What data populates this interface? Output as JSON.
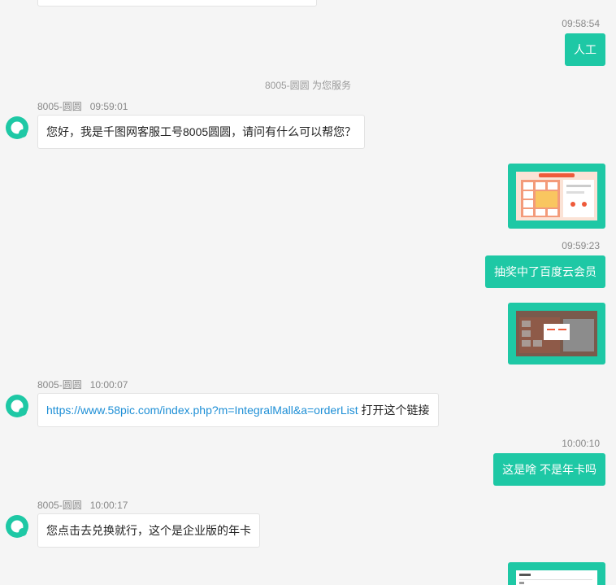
{
  "messages": [
    {
      "time": "09:58:54",
      "text": "人工"
    },
    {
      "system": "8005-圆圆 为您服务"
    },
    {
      "sender": "8005-圆圆",
      "time": "09:59:01",
      "text": "您好，我是千图网客服工号8005圆圆，请问有什么可以帮您？"
    },
    {
      "image": "prize-wheel-screenshot"
    },
    {
      "time": "09:59:23",
      "text": "抽奖中了百度云会员"
    },
    {
      "image": "prize-popup-screenshot"
    },
    {
      "sender": "8005-圆圆",
      "time": "10:00:07",
      "link": "https://www.58pic.com/index.php?m=IntegralMall&a=orderList",
      "text": " 打开这个链接"
    },
    {
      "time": "10:00:10",
      "text": "这是啥 不是年卡吗"
    },
    {
      "sender": "8005-圆圆",
      "time": "10:00:17",
      "text": "您点击去兑换就行，这个是企业版的年卡"
    },
    {
      "image": "order-list-screenshot"
    }
  ],
  "colors": {
    "accent": "#1ec8a5",
    "background": "#f5f5f5",
    "link": "#1e8fd6",
    "meta": "#888888"
  },
  "icons": {
    "agent_avatar": "ring-logo-icon"
  }
}
